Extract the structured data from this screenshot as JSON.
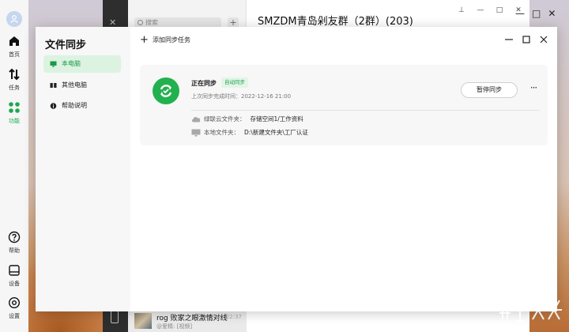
{
  "rail": {
    "items": [
      {
        "label": "首页",
        "icon": "home-icon"
      },
      {
        "label": "任务",
        "icon": "transfer-icon"
      },
      {
        "label": "功能",
        "icon": "apps-icon",
        "active": true
      },
      {
        "label": "帮助",
        "icon": "help-icon"
      },
      {
        "label": "设备",
        "icon": "device-icon"
      },
      {
        "label": "设置",
        "icon": "settings-icon"
      }
    ],
    "accent": "#1fa84f"
  },
  "chat_bg": {
    "title": "SMZDM青岛剁友群（2群）(203)",
    "search_placeholder": "搜索",
    "item": {
      "title": "rog 败家之眼激情对线",
      "sub": "@爱精: [视频]",
      "time": "22:37"
    }
  },
  "dialog": {
    "title": "文件同步",
    "sidebar": [
      {
        "label": "本电脑",
        "icon": "monitor-icon",
        "active": true
      },
      {
        "label": "其他电脑",
        "icon": "computers-icon"
      },
      {
        "label": "帮助说明",
        "icon": "info-icon"
      }
    ],
    "add_task": "添加同步任务",
    "card": {
      "status": "正在同步",
      "badge": "自动同步",
      "last_sync": "上次同步完成时间：2022-12-16 21:00",
      "pause_label": "暂停同步",
      "more": "···",
      "cloud_label": "绿联云文件夹：",
      "cloud_path": "存储空间1/工作资料",
      "local_label": "本地文件夹：",
      "local_path": "D:\\新建文件夹\\工厂认证"
    },
    "colors": {
      "accent": "#23b04e",
      "active_bg": "#dcf3e2"
    }
  }
}
